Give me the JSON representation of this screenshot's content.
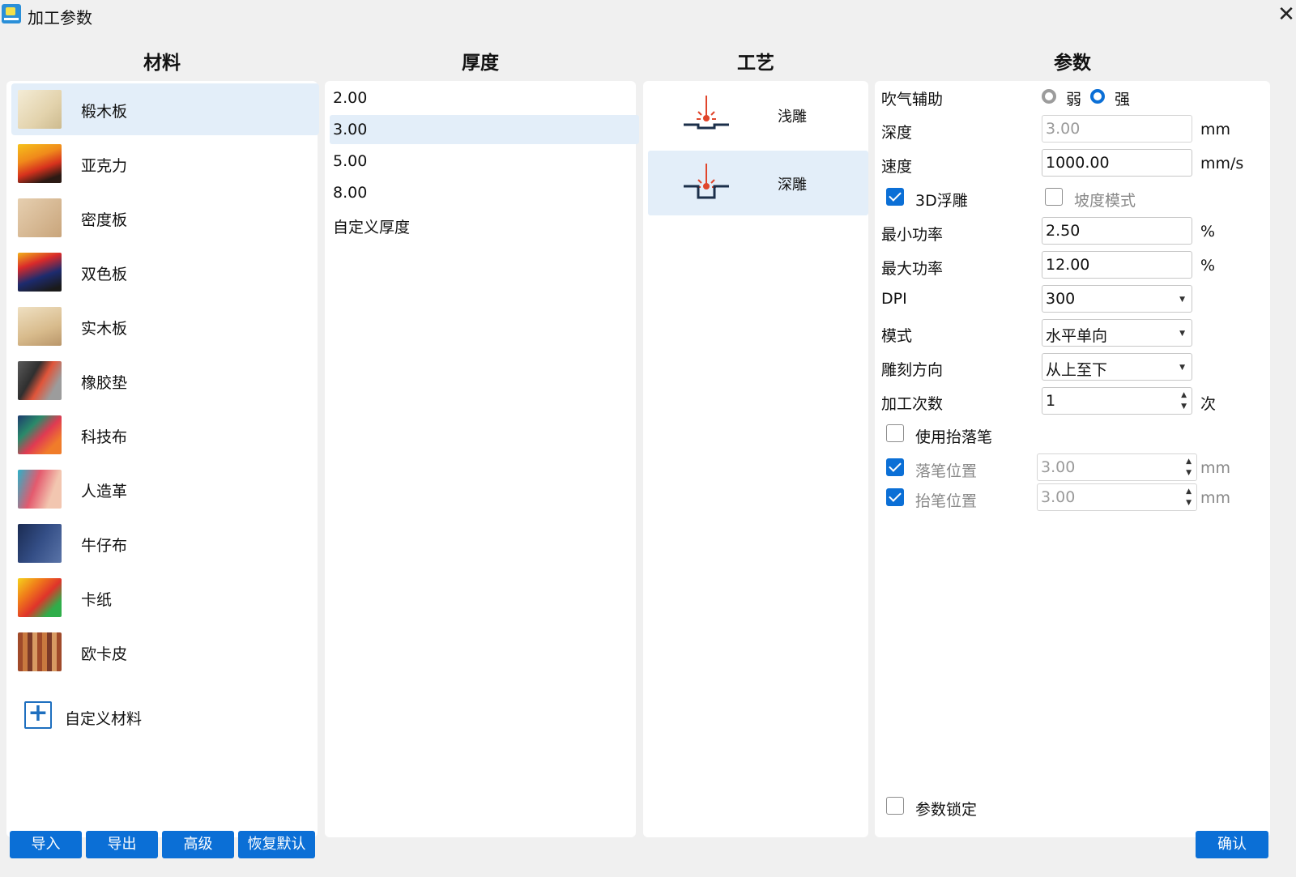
{
  "window": {
    "title": "加工参数",
    "app_icon": "app-logo-icon",
    "close_icon": "close-icon"
  },
  "headers": {
    "material": "材料",
    "thickness": "厚度",
    "process": "工艺",
    "params": "参数"
  },
  "materials": [
    {
      "label": "椴木板",
      "selected": true
    },
    {
      "label": "亚克力"
    },
    {
      "label": "密度板"
    },
    {
      "label": "双色板"
    },
    {
      "label": "实木板"
    },
    {
      "label": "橡胶垫"
    },
    {
      "label": "科技布"
    },
    {
      "label": "人造革"
    },
    {
      "label": "牛仔布"
    },
    {
      "label": "卡纸"
    },
    {
      "label": "欧卡皮"
    }
  ],
  "custom_material": {
    "label": "自定义材料",
    "icon": "plus-icon"
  },
  "thicknesses": [
    "2.00",
    "3.00",
    "5.00",
    "8.00",
    "自定义厚度"
  ],
  "selected_thickness": "3.00",
  "processes": [
    {
      "label": "浅雕",
      "icon": "laser-shallow-engrave-icon"
    },
    {
      "label": "深雕",
      "icon": "laser-deep-engrave-icon",
      "selected": true
    }
  ],
  "params": {
    "air_assist": {
      "label": "吹气辅助",
      "options": [
        "弱",
        "强"
      ],
      "selected": "强"
    },
    "depth": {
      "label": "深度",
      "value": "3.00",
      "unit": "mm"
    },
    "speed": {
      "label": "速度",
      "value": "1000.00",
      "unit": "mm/s"
    },
    "relief_3d": {
      "label": "3D浮雕",
      "checked": true
    },
    "slope_mode": {
      "label": "坡度模式",
      "checked": false
    },
    "min_power": {
      "label": "最小功率",
      "value": "2.50",
      "unit": "%"
    },
    "max_power": {
      "label": "最大功率",
      "value": "12.00",
      "unit": "%"
    },
    "dpi": {
      "label": "DPI",
      "value": "300"
    },
    "mode": {
      "label": "模式",
      "value": "水平单向"
    },
    "direction": {
      "label": "雕刻方向",
      "value": "从上至下"
    },
    "passes": {
      "label": "加工次数",
      "value": "1",
      "unit": "次"
    },
    "use_pen_lift": {
      "label": "使用抬落笔",
      "checked": false
    },
    "pen_down": {
      "label": "落笔位置",
      "value": "3.00",
      "unit": "mm",
      "checked": true
    },
    "pen_up": {
      "label": "抬笔位置",
      "value": "3.00",
      "unit": "mm",
      "checked": true
    },
    "lock": {
      "label": "参数锁定",
      "checked": false
    }
  },
  "buttons": {
    "import": "导入",
    "export": "导出",
    "advanced": "高级",
    "restore": "恢复默认",
    "confirm": "确认"
  },
  "colors": {
    "accent": "#0b6fd6",
    "selection": "#e3eef9",
    "laser_red": "#e0452b",
    "line_dark": "#1b2f4a"
  }
}
